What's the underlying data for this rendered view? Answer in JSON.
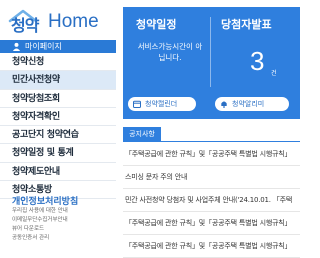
{
  "logo": {
    "ko": "청약",
    "en": "Home"
  },
  "sidebar": {
    "mypage_label": "마이페이지",
    "items": [
      {
        "label": "청약신청"
      },
      {
        "label": "민간사전청약"
      },
      {
        "label": "청약당첨조회"
      },
      {
        "label": "청약자격확인"
      },
      {
        "label": "공고단지 청약연습"
      },
      {
        "label": "청약일정 및 통계"
      },
      {
        "label": "청약제도안내"
      },
      {
        "label": "청약소통방"
      }
    ],
    "guide_title": "개인정보처리방침",
    "guide_links": [
      "우리집 사용에 대한 안내",
      "이메일무단수집거부안내",
      "뷰어 다운로드",
      "공동인증서 관리"
    ]
  },
  "card": {
    "schedule_title": "청약일정",
    "winner_title": "당첨자발표",
    "service_message": "서비스가능시간이 아닙니다.",
    "winner_count": "3",
    "winner_unit": "건",
    "calendar_button": "청약캘린더",
    "alarm_button": "청약알리미"
  },
  "notice": {
    "tab_label": "공지사항",
    "items": [
      "「주택공급에 관한 규칙」및「공공주택 특별법 시행규칙」",
      "스미싱 문자 주의 안내",
      "민간 사전청약 당첨자 및 사업주체 안내('24.10.01. 「주택",
      "「주택공급에 관한 규칙」및「공공주택 특별법 시행규칙」",
      "「주택공급에 관한 규칙」및「공공주택 특별법 시행규칙」"
    ]
  },
  "colors": {
    "brand": "#2f7fde",
    "highlight": "#dce9f7",
    "text": "#1c2a3a"
  },
  "icons": [
    "house-icon",
    "user-icon",
    "calendar-icon",
    "bell-icon"
  ]
}
